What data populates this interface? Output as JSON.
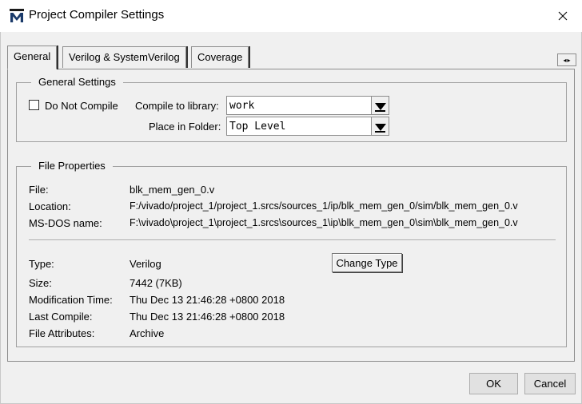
{
  "window": {
    "title": "Project Compiler Settings",
    "app_icon": "M"
  },
  "tabs": [
    {
      "label": "General"
    },
    {
      "label": "Verilog & SystemVerilog"
    },
    {
      "label": "Coverage"
    }
  ],
  "tab_scroll": {
    "left": "◂",
    "right": "▸"
  },
  "general_settings": {
    "title": "General Settings",
    "do_not_compile_label": "Do Not Compile",
    "do_not_compile_checked": false,
    "compile_to_library_label": "Compile to library:",
    "compile_to_library_value": "work",
    "place_in_folder_label": "Place in Folder:",
    "place_in_folder_value": "Top Level"
  },
  "file_properties": {
    "title": "File Properties",
    "rows_top": [
      {
        "label": "File:",
        "value": "blk_mem_gen_0.v"
      },
      {
        "label": "Location:",
        "value": "F:/vivado/project_1/project_1.srcs/sources_1/ip/blk_mem_gen_0/sim/blk_mem_gen_0.v"
      },
      {
        "label": "MS-DOS name:",
        "value": "F:\\vivado\\project_1\\project_1.srcs\\sources_1\\ip\\blk_mem_gen_0\\sim\\blk_mem_gen_0.v"
      }
    ],
    "rows_bottom": [
      {
        "label": "Type:",
        "value": "Verilog"
      },
      {
        "label": "Size:",
        "value": "7442 (7KB)"
      },
      {
        "label": "Modification Time:",
        "value": "Thu Dec 13 21:46:28 +0800 2018"
      },
      {
        "label": "Last Compile:",
        "value": "Thu Dec 13 21:46:28 +0800 2018"
      },
      {
        "label": "File Attributes:",
        "value": "Archive"
      }
    ],
    "change_type_label": "Change Type"
  },
  "footer": {
    "ok_label": "OK",
    "cancel_label": "Cancel"
  }
}
